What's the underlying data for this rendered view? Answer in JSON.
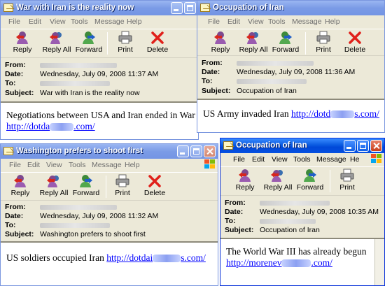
{
  "menus": [
    "File",
    "Edit",
    "View",
    "Tools",
    "Message",
    "Help"
  ],
  "menus_last_window": [
    "File",
    "Edit",
    "View",
    "Tools",
    "Message",
    "He"
  ],
  "toolbar": {
    "reply": "Reply",
    "reply_all": "Reply All",
    "forward": "Forward",
    "print": "Print",
    "delete": "Delete"
  },
  "labels": {
    "from": "From:",
    "date": "Date:",
    "to": "To:",
    "subject": "Subject:"
  },
  "windows": [
    {
      "title": "War with Iran is the reality now",
      "date": "Wednesday, July 09, 2008 11:37 AM",
      "subject": "War with Iran is the reality now",
      "body_text": "Negotiations between USA and Iran ended in War",
      "link_start": "http://dotda",
      "link_end": ".com/"
    },
    {
      "title": "Occupation of Iran",
      "date": "Wednesday, July 09, 2008 11:36 AM",
      "subject": "Occupation of Iran",
      "body_text": "US Army invaded Iran",
      "link_start": "http://dotd",
      "link_end": "s.com/"
    },
    {
      "title": "Washington prefers to shoot first",
      "date": "Wednesday, July 09, 2008 11:32 AM",
      "subject": "Washington prefers to shoot first",
      "body_text": "US soldiers occupied Iran",
      "link_start": "http://dotdai",
      "link_end": "s.com/"
    },
    {
      "title": "Occupation of Iran",
      "date": "Wednesday, July 09, 2008 10:35 AM",
      "subject": "Occupation of Iran",
      "body_text": "The World War III has already begun",
      "link_start": "http://morenev",
      "link_end": ".com/"
    }
  ],
  "colors": {
    "title_active": "#0a5ae0",
    "title_inactive": "#7b9be6",
    "link": "#0000ff",
    "chrome": "#ece9d8"
  }
}
